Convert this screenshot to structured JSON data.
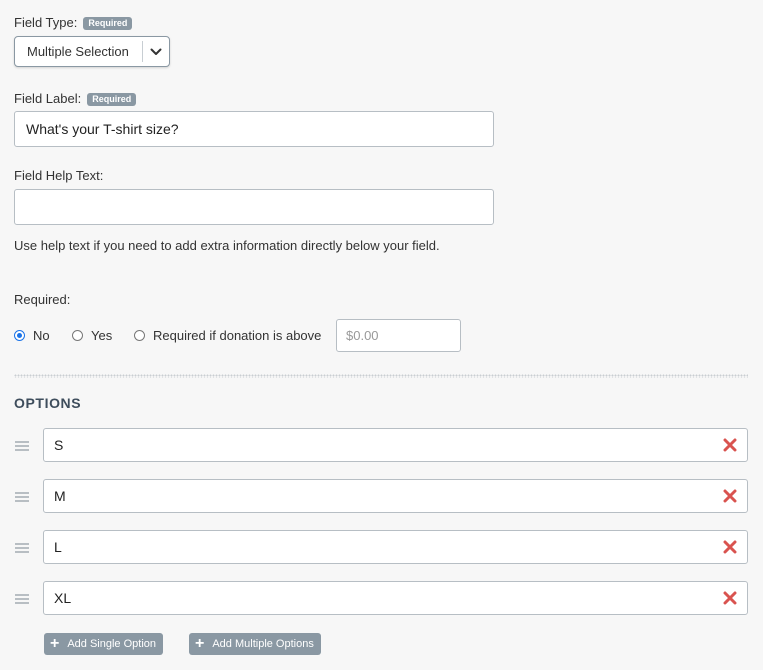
{
  "field_type": {
    "label": "Field Type:",
    "badge": "Required",
    "selected": "Multiple Selection"
  },
  "field_label": {
    "label": "Field Label:",
    "badge": "Required",
    "value": "What's your T-shirt size?"
  },
  "field_help": {
    "label": "Field Help Text:",
    "value": "",
    "hint": "Use help text if you need to add extra information directly below your field."
  },
  "required": {
    "label": "Required:",
    "options": [
      "No",
      "Yes",
      "Required if donation is above"
    ],
    "selected": "No",
    "amount_placeholder": "$0.00"
  },
  "options_section": {
    "title": "OPTIONS",
    "items": [
      "S",
      "M",
      "L",
      "XL"
    ],
    "add_single_label": "Add Single Option",
    "add_multiple_label": "Add Multiple Options"
  },
  "colors": {
    "accent": "#1a73e8",
    "remove": "#d9534f",
    "badge": "#8a98a3"
  }
}
